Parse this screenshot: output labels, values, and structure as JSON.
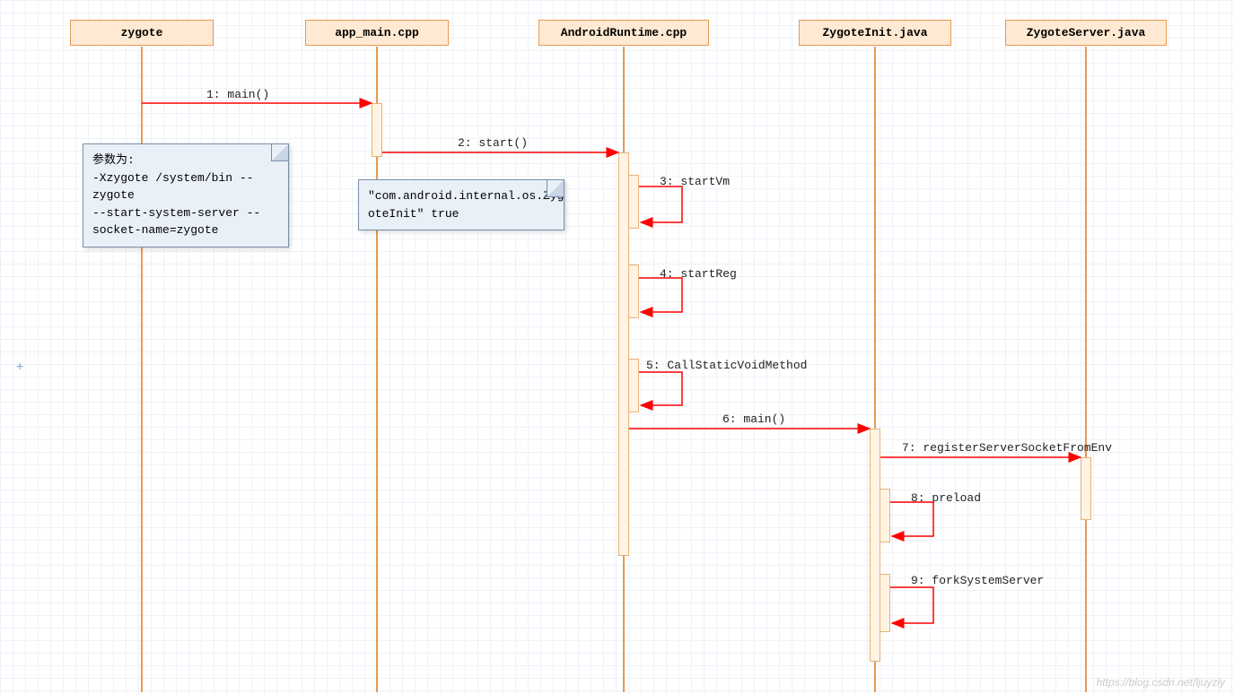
{
  "participants": {
    "p1": "zygote",
    "p2": "app_main.cpp",
    "p3": "AndroidRuntime.cpp",
    "p4": "ZygoteInit.java",
    "p5": "ZygoteServer.java"
  },
  "messages": {
    "m1": "1: main()",
    "m2": "2: start()",
    "m3": "3: startVm",
    "m4": "4: startReg",
    "m5": "5: CallStaticVoidMethod",
    "m6": "6: main()",
    "m7": "7: registerServerSocketFromEnv",
    "m8": "8: preload",
    "m9": "9: forkSystemServer"
  },
  "notes": {
    "n1": "参数为:\n-Xzygote /system/bin --zygote\n--start-system-server --\nsocket-name=zygote",
    "n2": "\"com.android.internal.os.Zyg\noteInit\" true"
  },
  "watermark": "https://blog.csdn.net/ljuyzly",
  "colors": {
    "participant_fill": "#ffe9d2",
    "participant_border": "#e69a53",
    "arrow": "#ff0000",
    "note_fill": "#e9f0f8",
    "note_border": "#7a8ea8"
  },
  "chart_data": {
    "type": "sequence-diagram",
    "participants": [
      "zygote",
      "app_main.cpp",
      "AndroidRuntime.cpp",
      "ZygoteInit.java",
      "ZygoteServer.java"
    ],
    "messages": [
      {
        "from": "zygote",
        "to": "app_main.cpp",
        "label": "1: main()"
      },
      {
        "from": "app_main.cpp",
        "to": "AndroidRuntime.cpp",
        "label": "2: start()"
      },
      {
        "from": "AndroidRuntime.cpp",
        "to": "AndroidRuntime.cpp",
        "label": "3: startVm"
      },
      {
        "from": "AndroidRuntime.cpp",
        "to": "AndroidRuntime.cpp",
        "label": "4: startReg"
      },
      {
        "from": "AndroidRuntime.cpp",
        "to": "AndroidRuntime.cpp",
        "label": "5: CallStaticVoidMethod"
      },
      {
        "from": "AndroidRuntime.cpp",
        "to": "ZygoteInit.java",
        "label": "6: main()"
      },
      {
        "from": "ZygoteInit.java",
        "to": "ZygoteServer.java",
        "label": "7: registerServerSocketFromEnv"
      },
      {
        "from": "ZygoteInit.java",
        "to": "ZygoteInit.java",
        "label": "8: preload"
      },
      {
        "from": "ZygoteInit.java",
        "to": "ZygoteInit.java",
        "label": "9: forkSystemServer"
      }
    ],
    "notes": [
      {
        "attached_to": "zygote",
        "text": "参数为:\n-Xzygote /system/bin --zygote\n--start-system-server --\nsocket-name=zygote"
      },
      {
        "attached_to": "app_main.cpp",
        "text": "\"com.android.internal.os.ZygoteInit\" true"
      }
    ]
  }
}
